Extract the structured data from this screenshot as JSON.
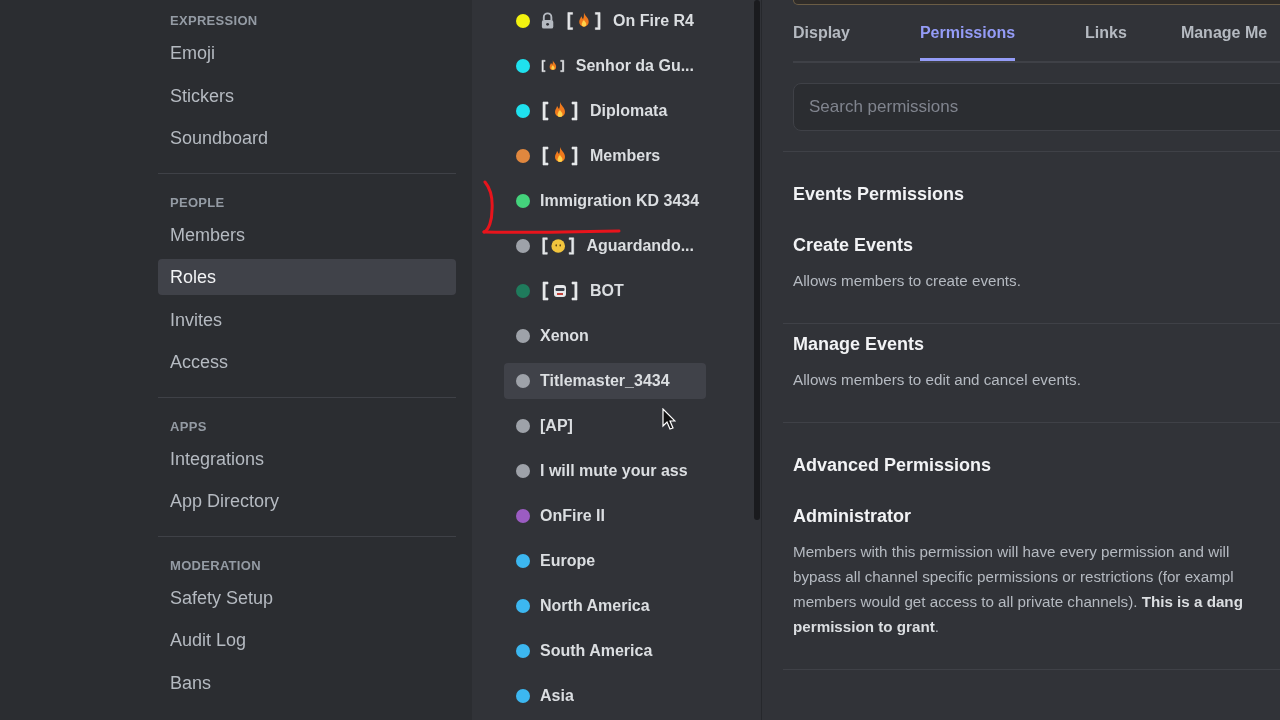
{
  "sidebar": {
    "sections": [
      {
        "title": "EXPRESSION",
        "items": [
          {
            "label": "Emoji",
            "selected": false
          },
          {
            "label": "Stickers",
            "selected": false
          },
          {
            "label": "Soundboard",
            "selected": false
          }
        ]
      },
      {
        "title": "PEOPLE",
        "items": [
          {
            "label": "Members",
            "selected": false
          },
          {
            "label": "Roles",
            "selected": true
          },
          {
            "label": "Invites",
            "selected": false
          },
          {
            "label": "Access",
            "selected": false
          }
        ]
      },
      {
        "title": "APPS",
        "items": [
          {
            "label": "Integrations",
            "selected": false
          },
          {
            "label": "App Directory",
            "selected": false
          }
        ]
      },
      {
        "title": "MODERATION",
        "items": [
          {
            "label": "Safety Setup",
            "selected": false
          },
          {
            "label": "Audit Log",
            "selected": false
          },
          {
            "label": "Bans",
            "selected": false
          }
        ]
      }
    ]
  },
  "roles": [
    {
      "name": "On Fire R4",
      "color": "#f2f20f",
      "locked": true,
      "kind": "fire",
      "hovered": false
    },
    {
      "name": "Senhor da Gu...",
      "color": "#1fe1ee",
      "locked": false,
      "kind": "fire",
      "hovered": false
    },
    {
      "name": "Diplomata",
      "color": "#1fe1ee",
      "locked": false,
      "kind": "fire",
      "hovered": false
    },
    {
      "name": "Members",
      "color": "#e0873e",
      "locked": false,
      "kind": "fire",
      "hovered": false
    },
    {
      "name": "Immigration KD 3434",
      "color": "#44d37c",
      "locked": false,
      "hovered": false
    },
    {
      "name": "Aguardando...",
      "color": "#9ea2a9",
      "locked": false,
      "kind": "face",
      "hovered": false
    },
    {
      "name": "BOT",
      "color": "#1f7b5c",
      "locked": false,
      "kind": "robot",
      "hovered": false
    },
    {
      "name": "Xenon",
      "color": "#9ea2a9",
      "locked": false,
      "hovered": false
    },
    {
      "name": "Titlemaster_3434",
      "color": "#9ea2a9",
      "locked": false,
      "hovered": true
    },
    {
      "name": "[AP]",
      "color": "#9ea2a9",
      "locked": false,
      "hovered": false
    },
    {
      "name": "I will mute your ass",
      "color": "#9ea2a9",
      "locked": false,
      "hovered": false
    },
    {
      "name": "OnFire II",
      "color": "#9b5cc2",
      "locked": false,
      "hovered": false
    },
    {
      "name": "Europe",
      "color": "#3cb7f0",
      "locked": false,
      "hovered": false
    },
    {
      "name": "North America",
      "color": "#3cb7f0",
      "locked": false,
      "hovered": false
    },
    {
      "name": "South America",
      "color": "#3cb7f0",
      "locked": false,
      "hovered": false
    },
    {
      "name": "Asia",
      "color": "#3cb7f0",
      "locked": false,
      "hovered": false
    }
  ],
  "tabs": [
    {
      "label": "Display",
      "selected": false
    },
    {
      "label": "Permissions",
      "selected": true
    },
    {
      "label": "Links",
      "selected": false
    },
    {
      "label": "Manage Me",
      "selected": false
    }
  ],
  "search": {
    "placeholder": "Search permissions"
  },
  "groups": [
    {
      "title": "Events Permissions",
      "permissions": [
        {
          "name": "Create Events",
          "description": [
            "Allows members to create events."
          ]
        },
        {
          "name": "Manage Events",
          "description": [
            "Allows members to edit and cancel events."
          ]
        }
      ]
    },
    {
      "title": "Advanced Permissions",
      "permissions": [
        {
          "name": "Administrator",
          "description": [
            "Members with this permission will have every permission and will",
            "bypass all channel specific permissions or restrictions (for exampl",
            "members would get access to all private channels). **This is a dang**",
            "**permission to grant**."
          ]
        }
      ]
    }
  ]
}
